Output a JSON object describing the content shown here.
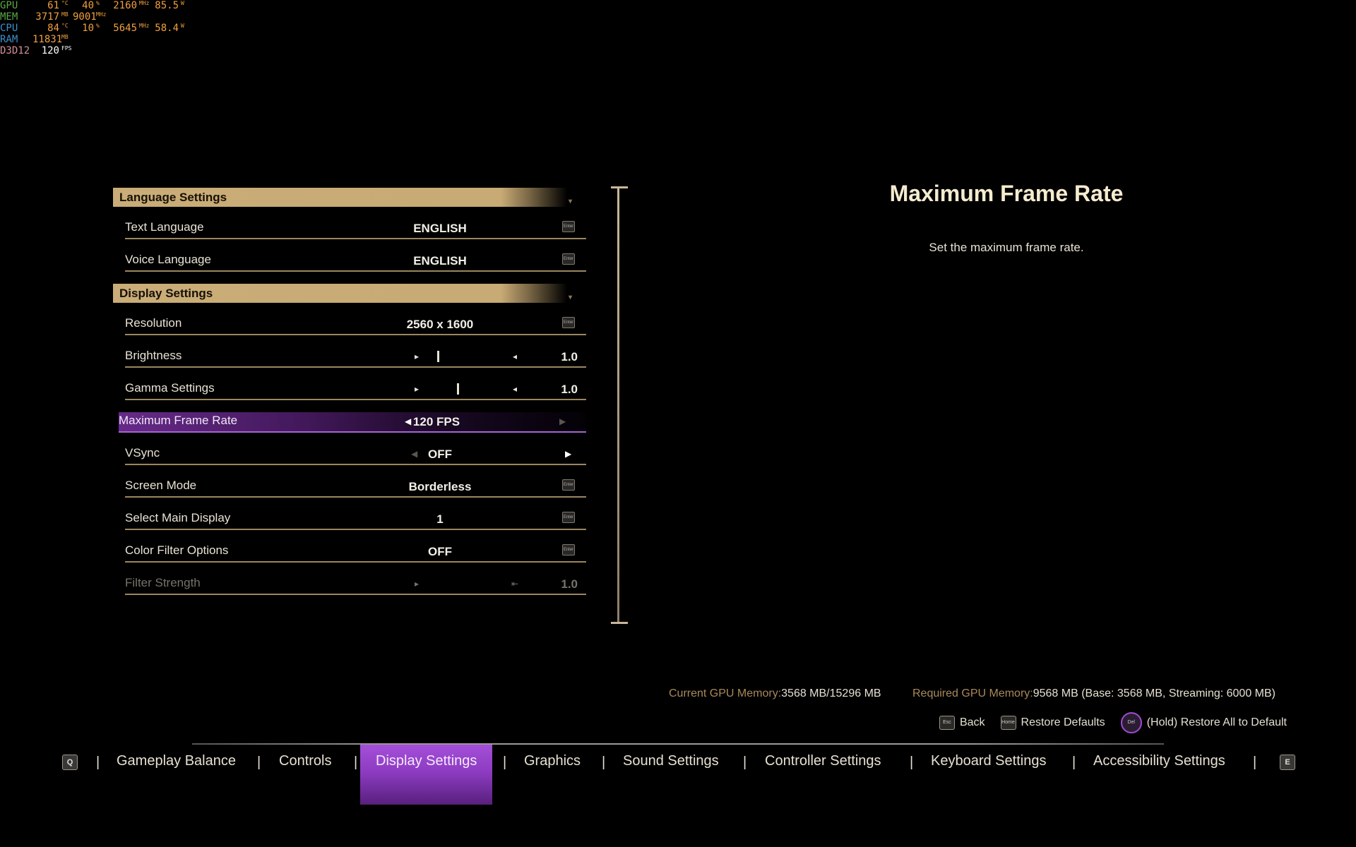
{
  "overlay": {
    "rows": [
      {
        "label": "GPU",
        "vals": [
          {
            "v": "61",
            "u": "°C"
          },
          {
            "v": "40",
            "u": "%"
          },
          {
            "v": "2160",
            "u": "MHz"
          },
          {
            "v": "85.5",
            "u": "W"
          }
        ]
      },
      {
        "label": "MEM",
        "vals": [
          {
            "v": "3717",
            "u": "MB"
          },
          {
            "v": "9001",
            "u": "MHz"
          }
        ]
      },
      {
        "label": "CPU",
        "vals": [
          {
            "v": "84",
            "u": "°C"
          },
          {
            "v": "10",
            "u": "%"
          },
          {
            "v": "5645",
            "u": "MHz"
          },
          {
            "v": "58.4",
            "u": "W"
          }
        ]
      },
      {
        "label": "RAM",
        "vals": [
          {
            "v": "11831",
            "u": "MB"
          }
        ]
      },
      {
        "label": "D3D12",
        "vals": [
          {
            "v": "120",
            "u": "FPS"
          }
        ]
      }
    ]
  },
  "sections": {
    "language": {
      "title": "Language Settings",
      "text_language": {
        "label": "Text Language",
        "value": "ENGLISH"
      },
      "voice_language": {
        "label": "Voice Language",
        "value": "ENGLISH"
      }
    },
    "display": {
      "title": "Display Settings",
      "resolution": {
        "label": "Resolution",
        "value": "2560 x 1600"
      },
      "brightness": {
        "label": "Brightness",
        "value": "1.0",
        "level": 0.1
      },
      "gamma": {
        "label": "Gamma Settings",
        "value": "1.0",
        "level": 0.35
      },
      "max_frame_rate": {
        "label": "Maximum Frame Rate",
        "value": "120 FPS"
      },
      "vsync": {
        "label": "VSync",
        "value": "OFF"
      },
      "screen_mode": {
        "label": "Screen Mode",
        "value": "Borderless"
      },
      "main_display": {
        "label": "Select Main Display",
        "value": "1"
      },
      "color_filter": {
        "label": "Color Filter Options",
        "value": "OFF"
      },
      "filter_strength": {
        "label": "Filter Strength",
        "value": "1.0"
      }
    }
  },
  "enter_key": "Enter",
  "description": {
    "title": "Maximum Frame Rate",
    "body": "Set the maximum frame rate."
  },
  "memory": {
    "current_label": "Current GPU Memory:",
    "current_value": "3568 MB/15296 MB",
    "required_label": "Required GPU Memory:",
    "required_value": "9568 MB (Base: 3568 MB, Streaming: 6000 MB)"
  },
  "hints": {
    "back_key": "Esc",
    "back": "Back",
    "restore_key": "Home",
    "restore": "Restore Defaults",
    "restore_all_key": "Del",
    "restore_all": "(Hold) Restore All to Default"
  },
  "tabs": {
    "left_key": "Q",
    "right_key": "E",
    "items": [
      "Gameplay Balance",
      "Controls",
      "Display Settings",
      "Graphics",
      "Sound Settings",
      "Controller Settings",
      "Keyboard Settings",
      "Accessibility Settings"
    ],
    "separator": "|"
  },
  "colors": {
    "accent": "#a44fd8",
    "header_gold": "#c9ac77"
  }
}
